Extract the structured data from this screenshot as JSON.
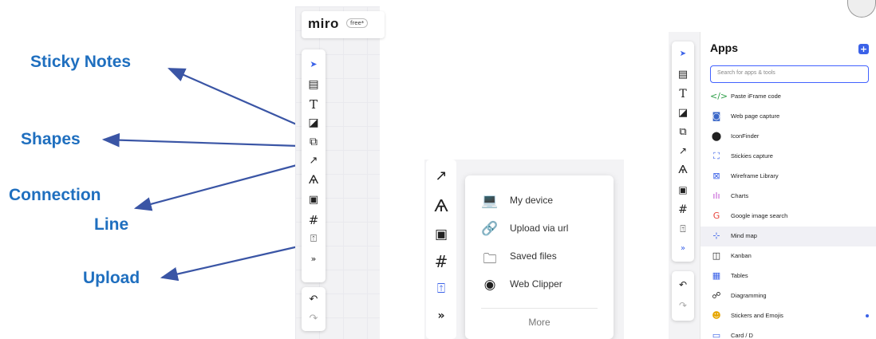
{
  "annotations": [
    "Sticky Notes",
    "Shapes",
    "Connection",
    "Line",
    "Upload"
  ],
  "board": {
    "logo": "miro",
    "plan_badge": "free*"
  },
  "toolbar_icons": [
    "select-cursor-icon",
    "templates-icon",
    "text-icon",
    "sticky-note-icon",
    "shapes-icon",
    "connection-line-icon",
    "pen-icon",
    "comment-icon",
    "frame-icon",
    "upload-icon",
    "more-icon",
    "undo-icon",
    "redo-icon"
  ],
  "toolbar_glyphs": {
    "select": "➤",
    "templates": "▤",
    "text": "T",
    "sticky": "◪",
    "shapes": "⧉",
    "line": "↗",
    "pen": "Ѧ",
    "comment": "▣",
    "frame": "#",
    "upload": "⍐",
    "more": "»",
    "undo": "↶",
    "redo": "↷"
  },
  "upload_menu": {
    "items": [
      {
        "label": "My device",
        "icon": "laptop-icon",
        "glyph": "💻"
      },
      {
        "label": "Upload via url",
        "icon": "link-icon",
        "glyph": "🔗"
      },
      {
        "label": "Saved files",
        "icon": "folder-icon",
        "glyph": "🗀"
      },
      {
        "label": "Web Clipper",
        "icon": "chrome-icon",
        "glyph": "◉"
      }
    ],
    "more": "More"
  },
  "apps_panel": {
    "title": "Apps",
    "add": "+",
    "search_placeholder": "Search for apps & tools",
    "items": [
      {
        "label": "Paste iFrame code",
        "icon": "code-icon",
        "glyph": "</>",
        "color": "#2e9e48"
      },
      {
        "label": "Web page capture",
        "icon": "camera-icon",
        "glyph": "◙",
        "color": "#3a67c8"
      },
      {
        "label": "IconFinder",
        "icon": "iconfinder-icon",
        "glyph": "⬤",
        "color": "#222222"
      },
      {
        "label": "Stickies capture",
        "icon": "scan-icon",
        "glyph": "⛶",
        "color": "#3b62e8"
      },
      {
        "label": "Wireframe Library",
        "icon": "wireframe-icon",
        "glyph": "⊠",
        "color": "#3b62e8"
      },
      {
        "label": "Charts",
        "icon": "chart-icon",
        "glyph": "ılı",
        "color": "#c04fd3"
      },
      {
        "label": "Google image search",
        "icon": "google-icon",
        "glyph": "G",
        "color": "#e8453c"
      },
      {
        "label": "Mind map",
        "icon": "mindmap-icon",
        "glyph": "⊹",
        "color": "#3b62e8"
      },
      {
        "label": "Kanban",
        "icon": "kanban-icon",
        "glyph": "◫",
        "color": "#222222"
      },
      {
        "label": "Tables",
        "icon": "table-icon",
        "glyph": "▦",
        "color": "#3b62e8"
      },
      {
        "label": "Diagramming",
        "icon": "diagram-icon",
        "glyph": "☍",
        "color": "#222222"
      },
      {
        "label": "Stickers and Emojis",
        "icon": "emoji-icon",
        "glyph": "☻",
        "color": "#e6a600"
      },
      {
        "label": "Card / D",
        "icon": "card-icon",
        "glyph": "▭",
        "color": "#3b62e8"
      }
    ]
  }
}
